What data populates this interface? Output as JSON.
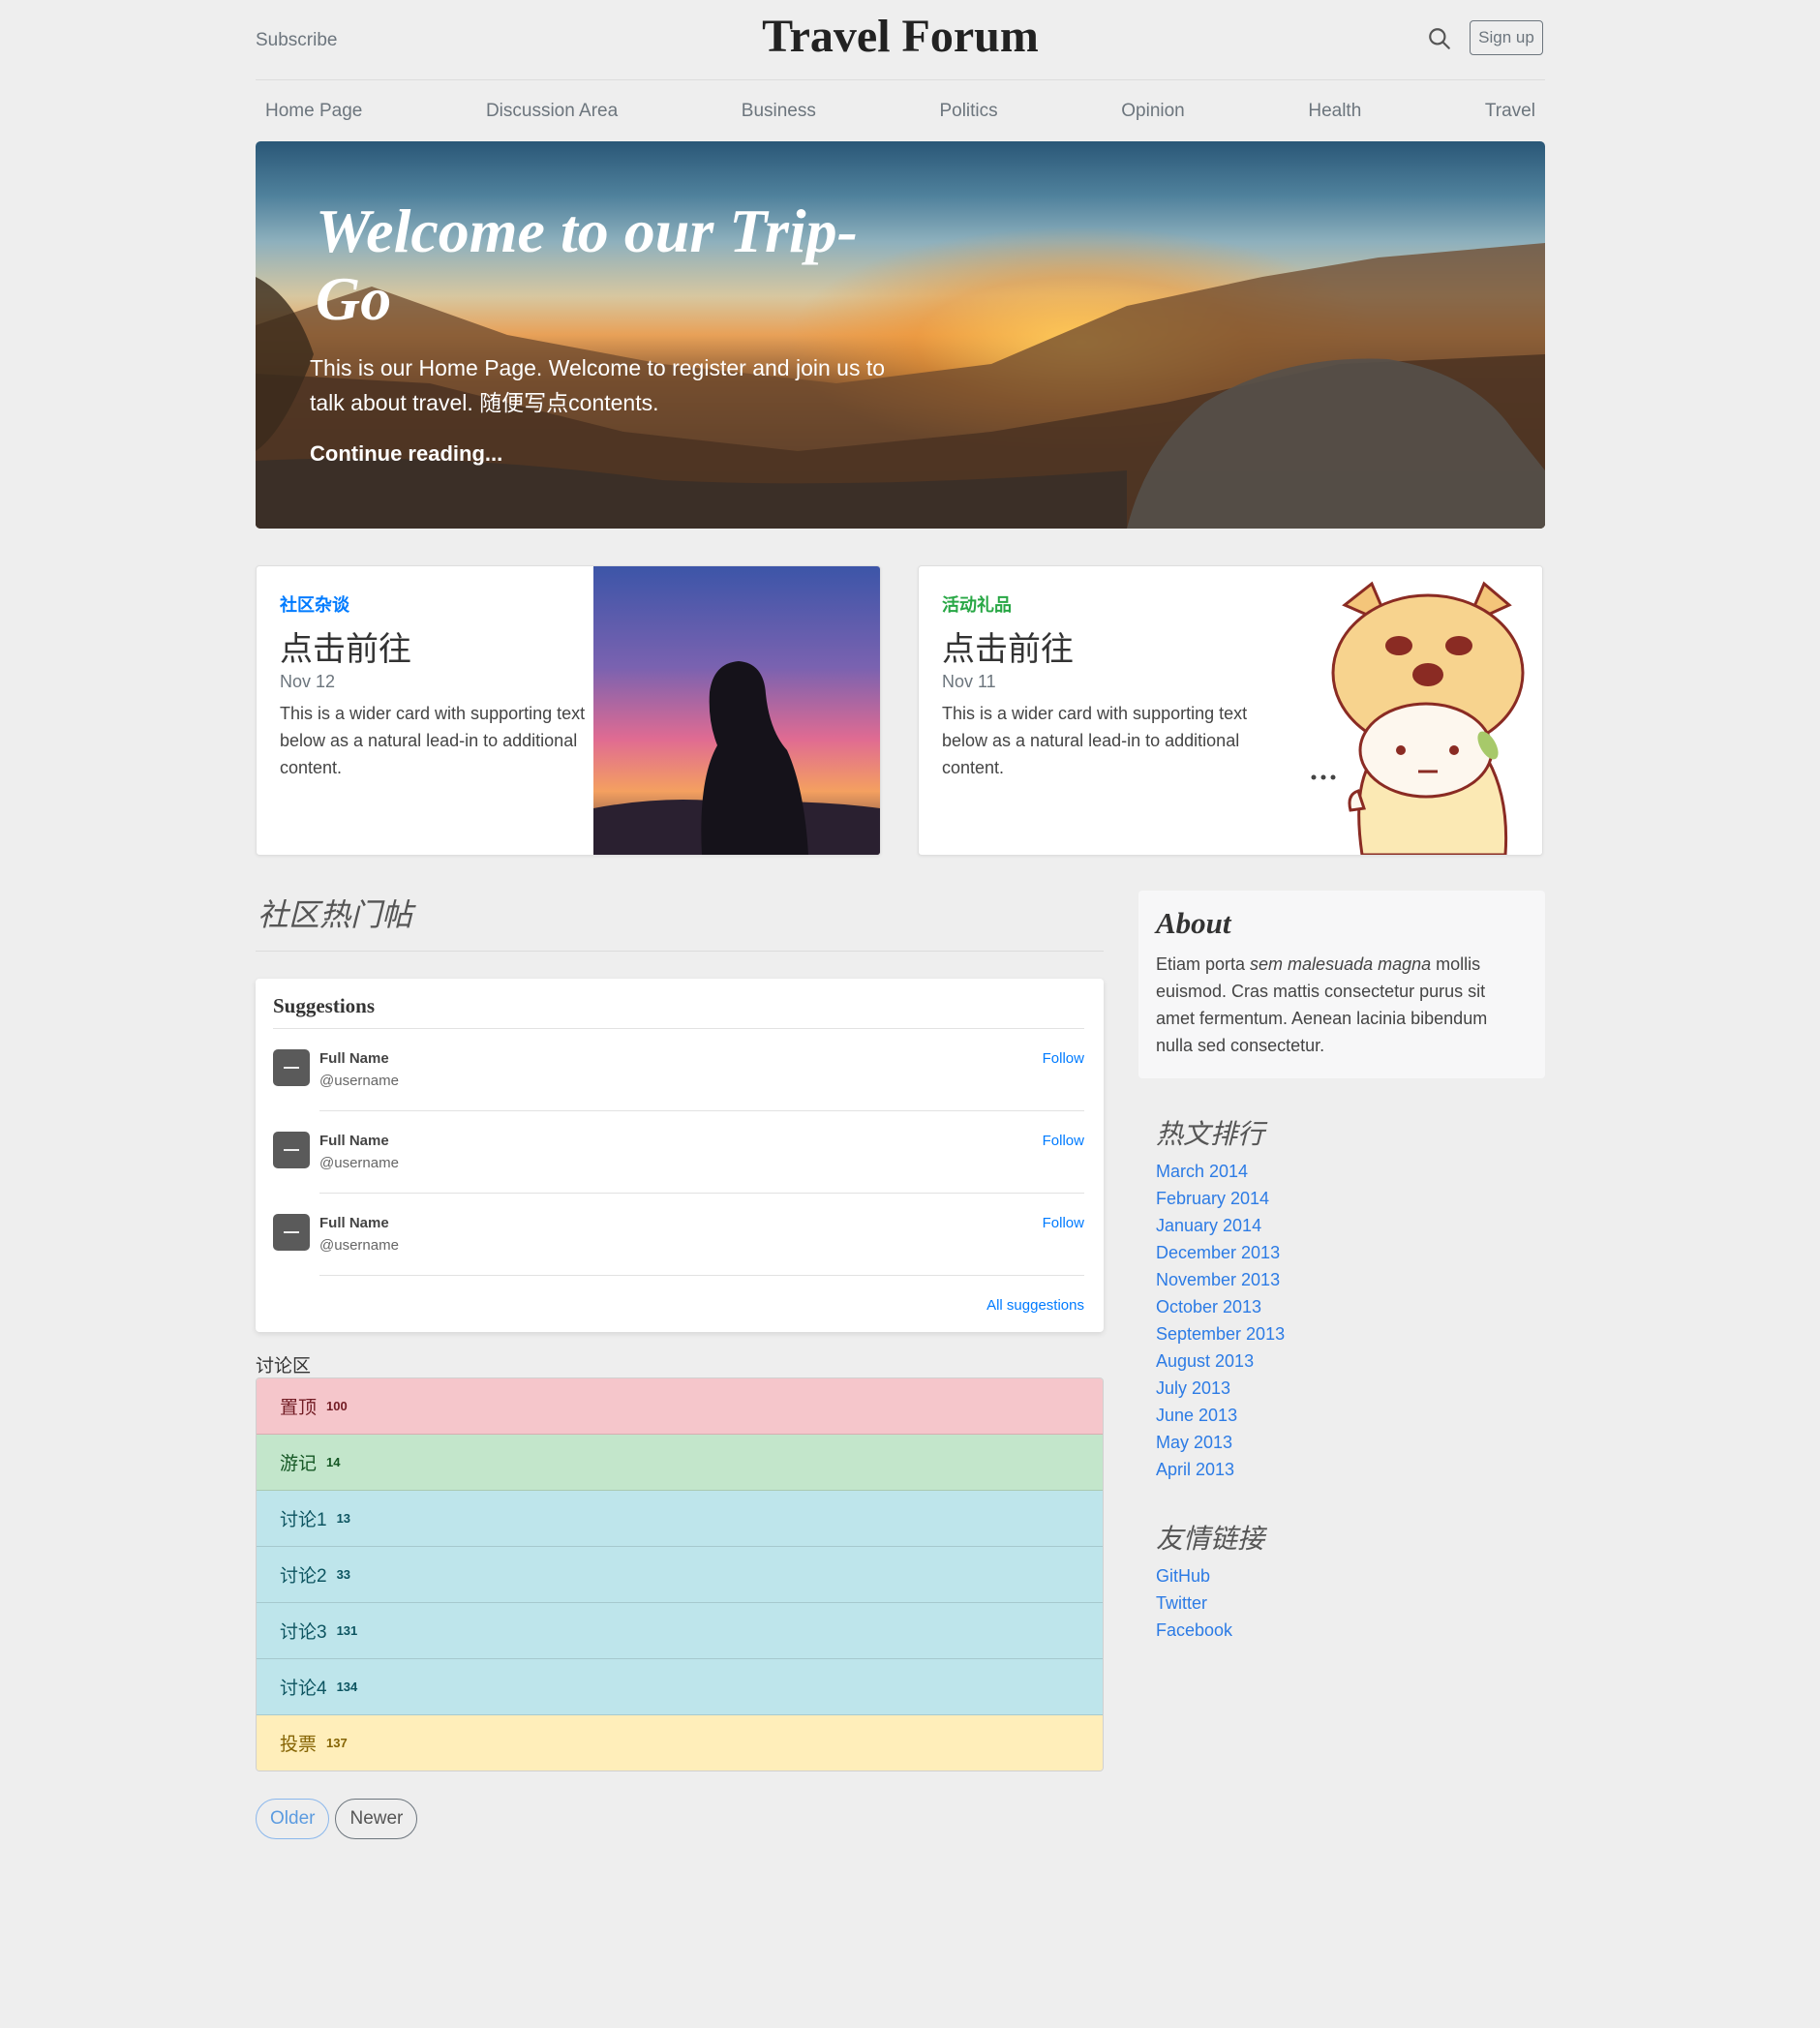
{
  "header": {
    "subscribe": "Subscribe",
    "title": "Travel Forum",
    "signup": "Sign up"
  },
  "nav": [
    "Home Page",
    "Discussion Area",
    "Business",
    "Politics",
    "Opinion",
    "Health",
    "Travel"
  ],
  "hero": {
    "title": "Welcome to our Trip-Go",
    "lead": "This is our Home Page. Welcome to register and join us to talk about travel. 随便写点contents.",
    "link": "Continue reading..."
  },
  "cards": [
    {
      "category": "社区杂谈",
      "category_color": "#007bff",
      "title": "点击前往",
      "date": "Nov 12",
      "text": "This is a wider card with supporting text below as a natural lead-in to additional content."
    },
    {
      "category": "活动礼品",
      "category_color": "#28a745",
      "title": "点击前往",
      "date": "Nov 11",
      "text": "This is a wider card with supporting text below as a natural lead-in to additional content."
    }
  ],
  "main": {
    "section_title": "社区热门帖",
    "suggestions": {
      "title": "Suggestions",
      "rows": [
        {
          "name": "Full Name",
          "username": "@username",
          "follow": "Follow"
        },
        {
          "name": "Full Name",
          "username": "@username",
          "follow": "Follow"
        },
        {
          "name": "Full Name",
          "username": "@username",
          "follow": "Follow"
        }
      ],
      "all": "All suggestions"
    },
    "discussion_label": "讨论区",
    "discussion": [
      {
        "label": "置顶",
        "count": "100",
        "variant": "danger"
      },
      {
        "label": "游记",
        "count": "14",
        "variant": "success"
      },
      {
        "label": "讨论1",
        "count": "13",
        "variant": "info"
      },
      {
        "label": "讨论2",
        "count": "33",
        "variant": "info"
      },
      {
        "label": "讨论3",
        "count": "131",
        "variant": "info"
      },
      {
        "label": "讨论4",
        "count": "134",
        "variant": "info"
      },
      {
        "label": "投票",
        "count": "137",
        "variant": "warning"
      }
    ],
    "pager": {
      "older": "Older",
      "newer": "Newer"
    }
  },
  "sidebar": {
    "about_title": "About",
    "about_pre": "Etiam porta ",
    "about_em": "sem malesuada magna",
    "about_post": " mollis euismod. Cras mattis consectetur purus sit amet fermentum. Aenean lacinia bibendum nulla sed consectetur.",
    "archives_title": "热文排行",
    "archives": [
      "March 2014",
      "February 2014",
      "January 2014",
      "December 2013",
      "November 2013",
      "October 2013",
      "September 2013",
      "August 2013",
      "July 2013",
      "June 2013",
      "May 2013",
      "April 2013"
    ],
    "links_title": "友情链接",
    "links": [
      "GitHub",
      "Twitter",
      "Facebook"
    ]
  },
  "icons": {
    "search": "search-icon",
    "avatar": "avatar-placeholder-icon"
  }
}
